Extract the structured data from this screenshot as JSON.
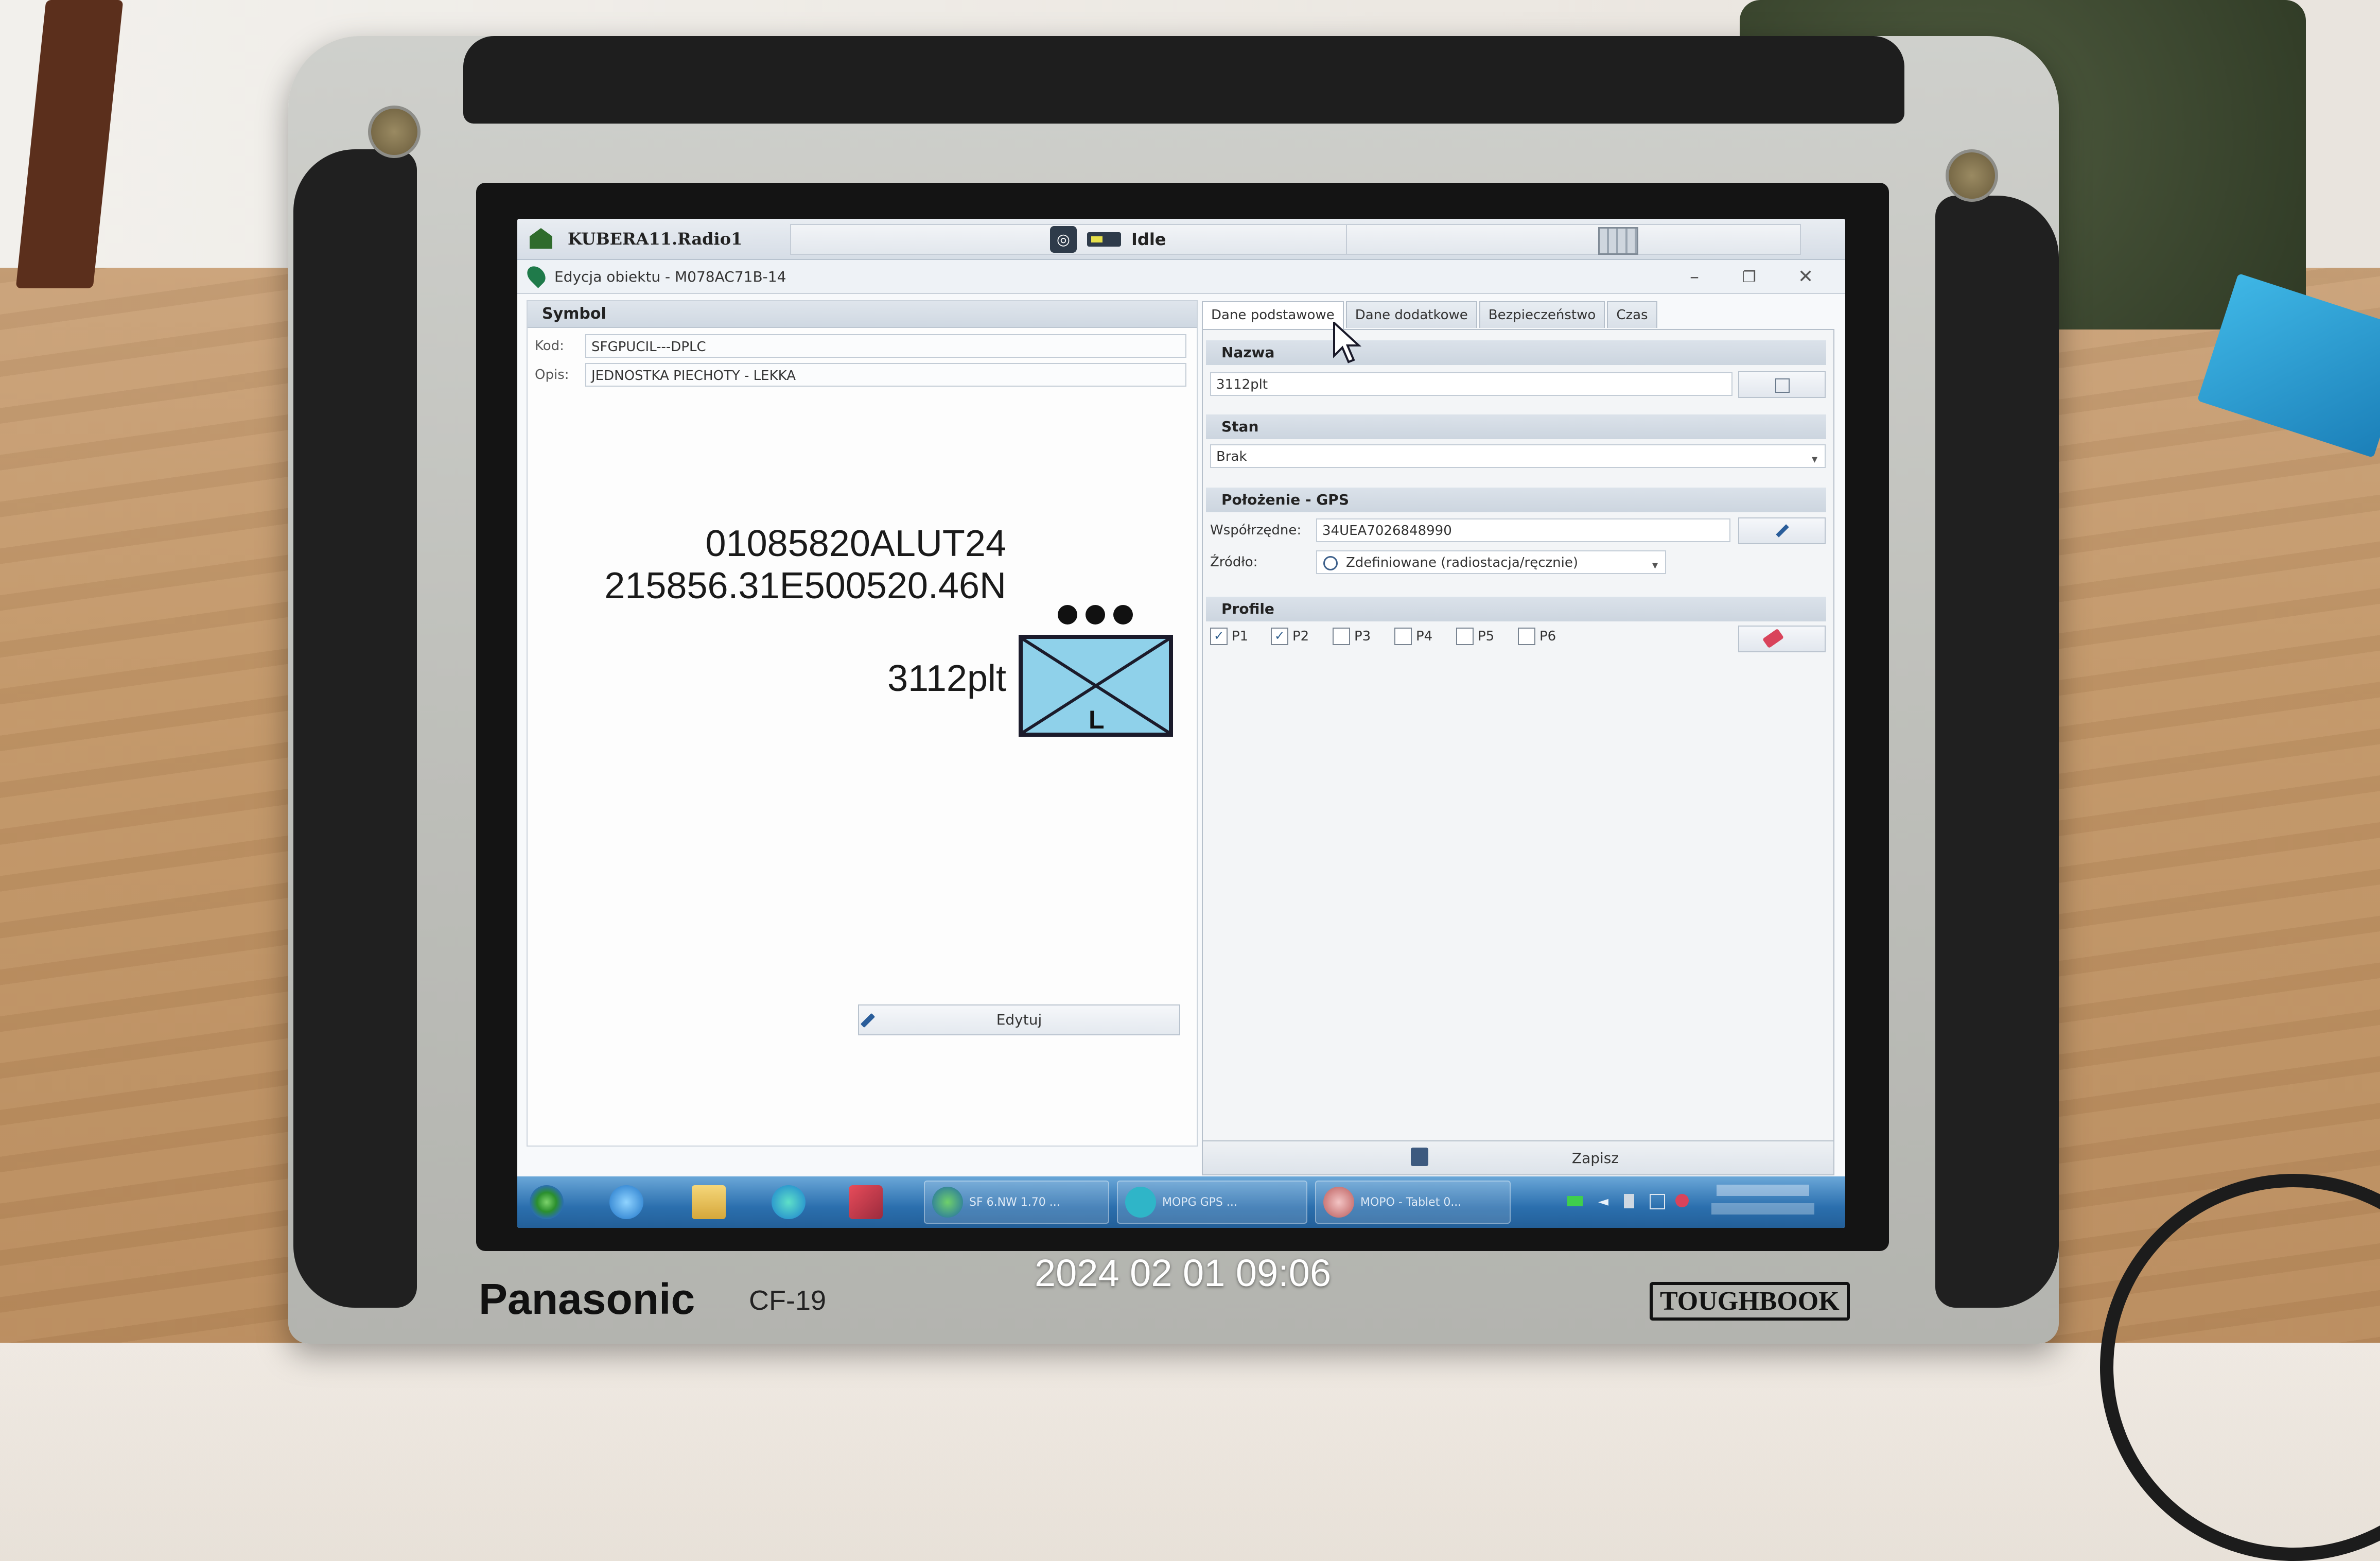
{
  "app": {
    "title": "KUBERA11.Radio1",
    "status": "Idle",
    "subtitle": "Edycja obiektu - M078AC71B-14",
    "window_controls": [
      "–",
      "❐",
      "✕"
    ]
  },
  "symbol_panel": {
    "header": "Symbol",
    "kod_label": "Kod:",
    "kod_value": "SFGPUCIL---DPLC",
    "opis_label": "Opis:",
    "opis_value": "JEDNOSTKA PIECHOTY - LEKKA",
    "line1": "01085820ALUT24",
    "line2": "215856.31E500520.46N",
    "line3": "3112plt",
    "unit_letter": "L",
    "edit_label": "Edytuj"
  },
  "tabs": [
    {
      "label": "Dane podstawowe",
      "active": true
    },
    {
      "label": "Dane dodatkowe",
      "active": false
    },
    {
      "label": "Bezpieczeństwo",
      "active": false
    },
    {
      "label": "Czas",
      "active": false
    }
  ],
  "form": {
    "nazwa_header": "Nazwa",
    "nazwa_value": "3112plt",
    "stan_header": "Stan",
    "stan_value": "Brak",
    "gps_header": "Położenie - GPS",
    "wsp_label": "Współrzędne:",
    "wsp_value": "34UEA7026848990",
    "zrodlo_label": "Źródło:",
    "zrodlo_value": "Zdefiniowane (radiostacja/ręcznie)",
    "profile_header": "Profile",
    "profiles": [
      {
        "label": "P1",
        "checked": true
      },
      {
        "label": "P2",
        "checked": true
      },
      {
        "label": "P3",
        "checked": false
      },
      {
        "label": "P4",
        "checked": false
      },
      {
        "label": "P5",
        "checked": false
      },
      {
        "label": "P6",
        "checked": false
      }
    ],
    "save_label": "Zapisz"
  },
  "taskbar": {
    "windows": [
      "SF 6.NW 1.70 ...",
      "MOPG GPS ...",
      "MOPO - Tablet 0..."
    ]
  },
  "device": {
    "brand": "Panasonic",
    "model": "CF-19",
    "line": "TOUGHBOOK",
    "photo_timestamp": "2024 02 01 09:06"
  },
  "colors": {
    "unit_fill": "#8fd1ea",
    "taskbar": "#2b6fae",
    "header_bg": "#d6dde6"
  }
}
